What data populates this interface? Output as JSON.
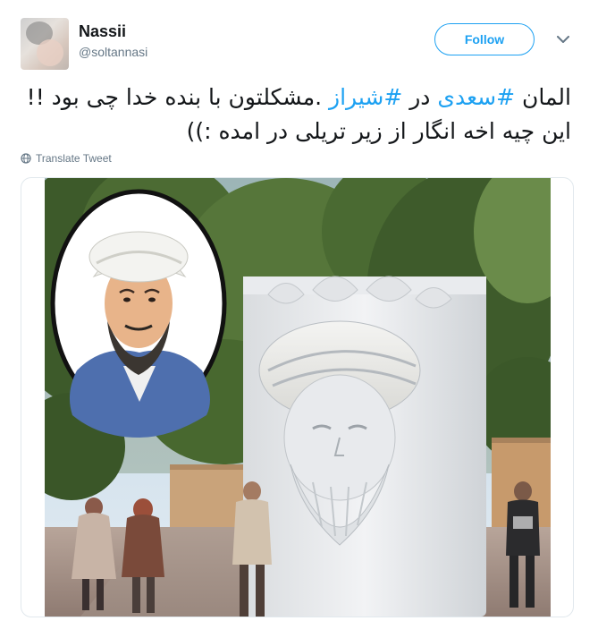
{
  "tweet": {
    "display_name": "Nassii",
    "screen_name": "@soltannasi",
    "follow_label": "Follow",
    "text": {
      "line1_part1": "المان ",
      "hashtag1": "#سعدی",
      "line1_part2": " در ",
      "hashtag2": "#شیراز",
      "line1_part3": " .مشکلتون با بنده خدا چی بود !!",
      "line2": "این چیه اخه انگار از زیر تریلی در امده :))"
    },
    "translate_label": "Translate Tweet"
  },
  "colors": {
    "accent": "#1da1f2",
    "text": "#14171a",
    "secondary": "#657786",
    "border": "#e1e8ed"
  },
  "icons": {
    "menu": "chevron-down-icon",
    "translate": "globe-icon"
  }
}
